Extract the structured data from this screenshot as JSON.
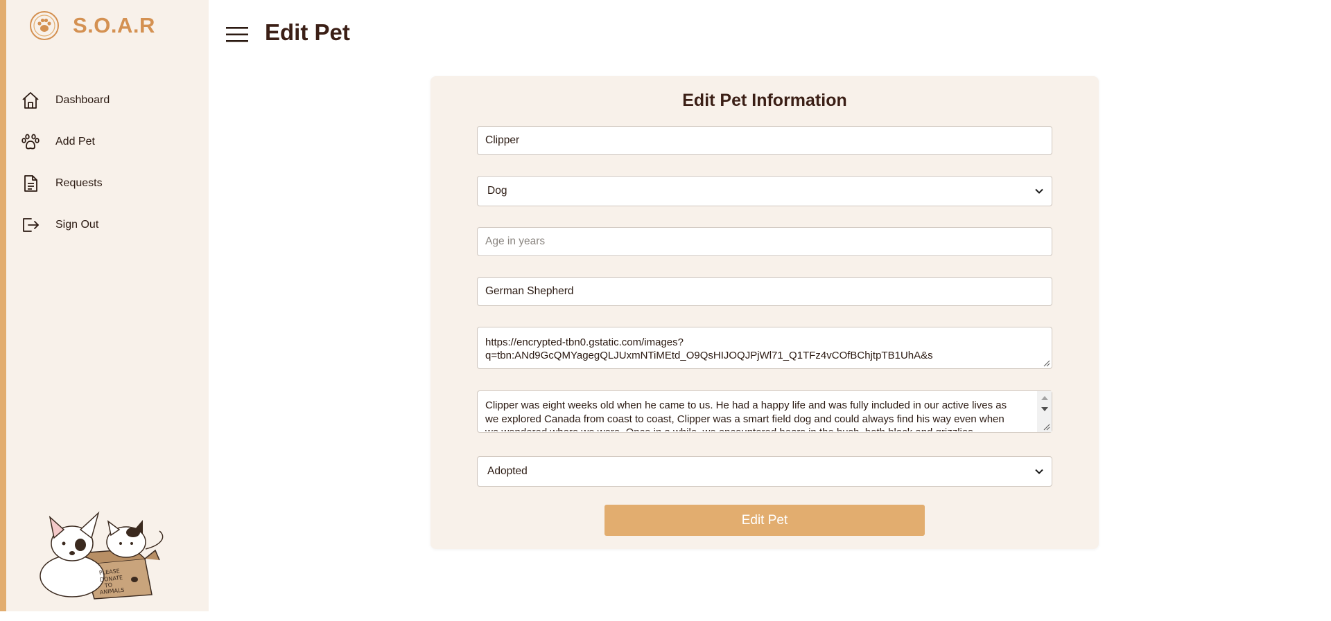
{
  "brand": {
    "name": "S.O.A.R"
  },
  "colors": {
    "accent": "#e2ad6f",
    "brand_text": "#d49152",
    "sidebar_bg": "#f8f1ea",
    "heading": "#3b1f16"
  },
  "sidebar": {
    "items": [
      {
        "label": "Dashboard",
        "icon": "home-icon"
      },
      {
        "label": "Add Pet",
        "icon": "paw-icon"
      },
      {
        "label": "Requests",
        "icon": "document-icon"
      },
      {
        "label": "Sign Out",
        "icon": "sign-out-icon"
      }
    ],
    "art_text": "PLEASE DONATE TO ANIMALS"
  },
  "header": {
    "title": "Edit Pet"
  },
  "form": {
    "title": "Edit Pet Information",
    "name_value": "Clipper",
    "type_value": "Dog",
    "age_value": "",
    "age_placeholder": "Age in years",
    "breed_value": "German Shepherd",
    "image_url_value": "https://encrypted-tbn0.gstatic.com/images?q=tbn:ANd9GcQMYagegQLJUxmNTiMEtd_O9QsHIJOQJPjWl71_Q1TFz4vCOfBChjtpTB1UhA&s",
    "image_url_line1": "https://encrypted-tbn0.gstatic.com/images?",
    "image_url_line2": "q=tbn:ANd9GcQMYagegQLJUxmNTiMEtd_O9QsHIJOQJPjWl71_Q1TFz4vCOfBChjtpTB1UhA&s",
    "description_line1": "Clipper was eight weeks old when he came to us. He had a happy life and was fully included in our active lives as",
    "description_line2": "we explored Canada from coast to coast, Clipper was a smart field dog and could always find his way even when",
    "description_line3": "we wondered where we were. Once in a while, we encountered bears in the bush, both black and grizzlies.",
    "status_value": "Adopted",
    "submit_label": "Edit Pet"
  }
}
